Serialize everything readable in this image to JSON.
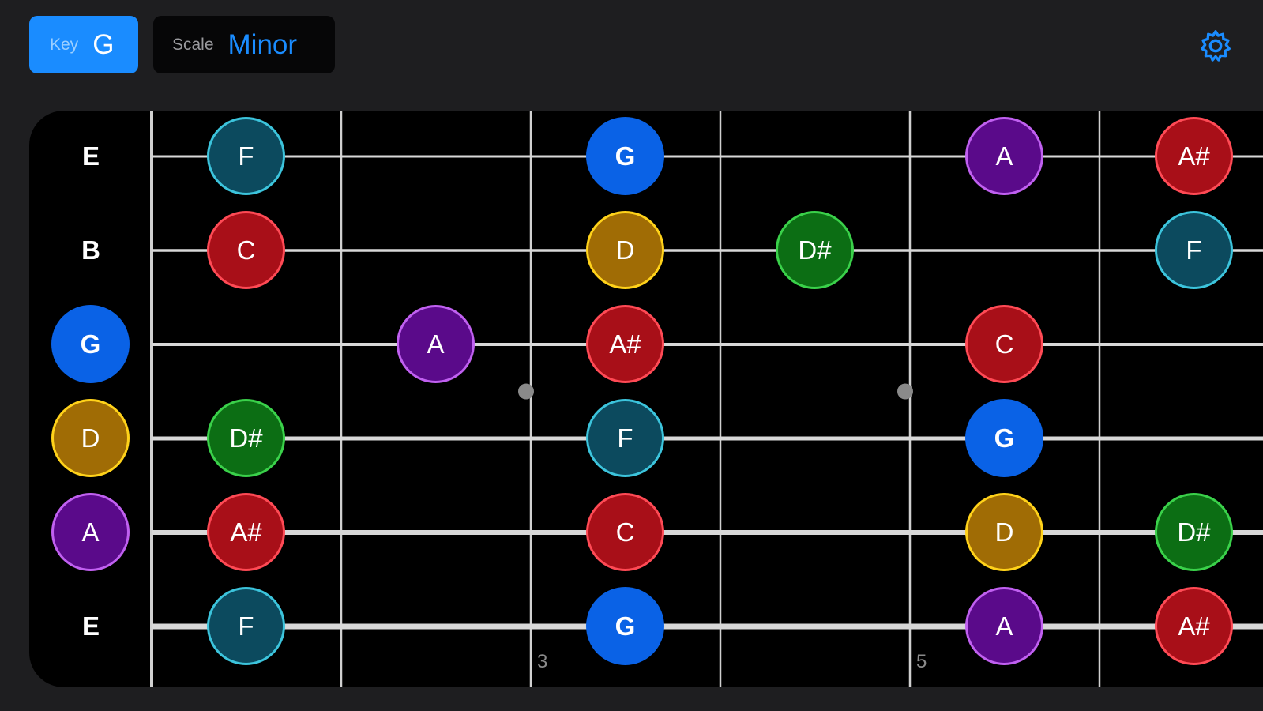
{
  "header": {
    "key_label": "Key",
    "key_value": "G",
    "scale_label": "Scale",
    "scale_value": "Minor",
    "settings_icon": "gear-icon"
  },
  "colors": {
    "accent": "#1a8cff",
    "G": {
      "fill": "#0a62e6",
      "border": "#0a62e6"
    },
    "A": {
      "fill": "#5a0a8a",
      "border": "#c060f0"
    },
    "A#": {
      "fill": "#a80f18",
      "border": "#ff4a55"
    },
    "C": {
      "fill": "#a80f18",
      "border": "#ff4a55"
    },
    "D": {
      "fill": "#a06c05",
      "border": "#ffd21a"
    },
    "D#": {
      "fill": "#0c6e14",
      "border": "#3ad14a"
    },
    "F": {
      "fill": "#0c4a5e",
      "border": "#3cc4dc"
    }
  },
  "fretboard": {
    "open_strings": [
      {
        "label": "E",
        "circled": false
      },
      {
        "label": "B",
        "circled": false
      },
      {
        "label": "G",
        "circled": true
      },
      {
        "label": "D",
        "circled": true
      },
      {
        "label": "A",
        "circled": true
      },
      {
        "label": "E",
        "circled": false
      }
    ],
    "fret_numbers": [
      {
        "fret": 3,
        "label": "3"
      },
      {
        "fret": 5,
        "label": "5"
      }
    ],
    "inlay_frets": [
      3,
      5
    ],
    "notes": [
      {
        "string": 0,
        "fret": 1,
        "label": "F"
      },
      {
        "string": 0,
        "fret": 3,
        "label": "G"
      },
      {
        "string": 0,
        "fret": 5,
        "label": "A"
      },
      {
        "string": 0,
        "fret": 6,
        "label": "A#"
      },
      {
        "string": 1,
        "fret": 1,
        "label": "C"
      },
      {
        "string": 1,
        "fret": 3,
        "label": "D"
      },
      {
        "string": 1,
        "fret": 4,
        "label": "D#"
      },
      {
        "string": 1,
        "fret": 6,
        "label": "F"
      },
      {
        "string": 2,
        "fret": 2,
        "label": "A"
      },
      {
        "string": 2,
        "fret": 3,
        "label": "A#"
      },
      {
        "string": 2,
        "fret": 5,
        "label": "C"
      },
      {
        "string": 3,
        "fret": 1,
        "label": "D#"
      },
      {
        "string": 3,
        "fret": 3,
        "label": "F"
      },
      {
        "string": 3,
        "fret": 5,
        "label": "G"
      },
      {
        "string": 4,
        "fret": 1,
        "label": "A#"
      },
      {
        "string": 4,
        "fret": 3,
        "label": "C"
      },
      {
        "string": 4,
        "fret": 5,
        "label": "D"
      },
      {
        "string": 4,
        "fret": 6,
        "label": "D#"
      },
      {
        "string": 5,
        "fret": 1,
        "label": "F"
      },
      {
        "string": 5,
        "fret": 3,
        "label": "G"
      },
      {
        "string": 5,
        "fret": 5,
        "label": "A"
      },
      {
        "string": 5,
        "fret": 6,
        "label": "A#"
      }
    ]
  }
}
